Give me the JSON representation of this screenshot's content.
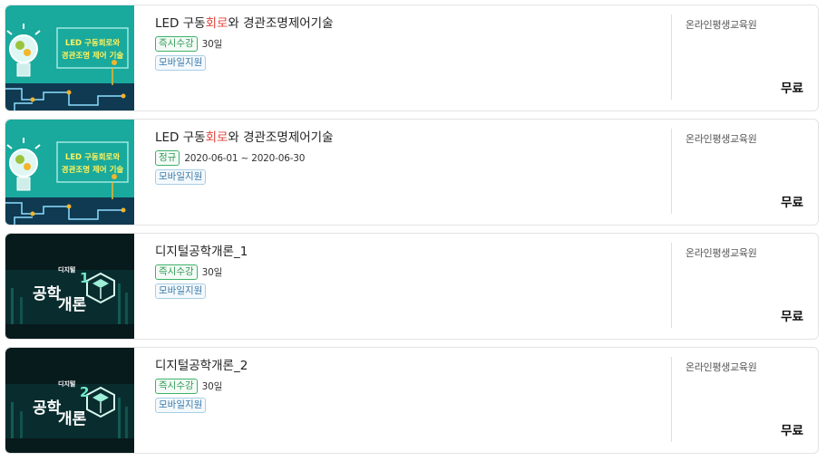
{
  "courses": [
    {
      "title_pre": "LED 구동",
      "title_hl": "회로",
      "title_post": "와 경관조명제어기술",
      "thumb_text_1": "LED 구동회로와",
      "thumb_text_2": "경관조명 제어 기술",
      "badge": "즉시수강",
      "period": "30일",
      "mobile": "모바일지원",
      "provider": "온라인평생교육원",
      "price": "무료"
    },
    {
      "title_pre": "LED 구동",
      "title_hl": "회로",
      "title_post": "와 경관조명제어기술",
      "thumb_text_1": "LED 구동회로와",
      "thumb_text_2": "경관조명 제어 기술",
      "badge": "정규",
      "period": "2020-06-01 ~ 2020-06-30",
      "mobile": "모바일지원",
      "provider": "온라인평생교육원",
      "price": "무료"
    },
    {
      "title": "디지털공학개론_1",
      "thumb_small": "디지털",
      "thumb_big_1": "공학",
      "thumb_big_2": "개론",
      "thumb_num": "1",
      "badge": "즉시수강",
      "period": "30일",
      "mobile": "모바일지원",
      "provider": "온라인평생교육원",
      "price": "무료"
    },
    {
      "title": "디지털공학개론_2",
      "thumb_small": "디지털",
      "thumb_big_1": "공학",
      "thumb_big_2": "개론",
      "thumb_num": "2",
      "badge": "즉시수강",
      "period": "30일",
      "mobile": "모바일지원",
      "provider": "온라인평생교육원",
      "price": "무료"
    }
  ]
}
